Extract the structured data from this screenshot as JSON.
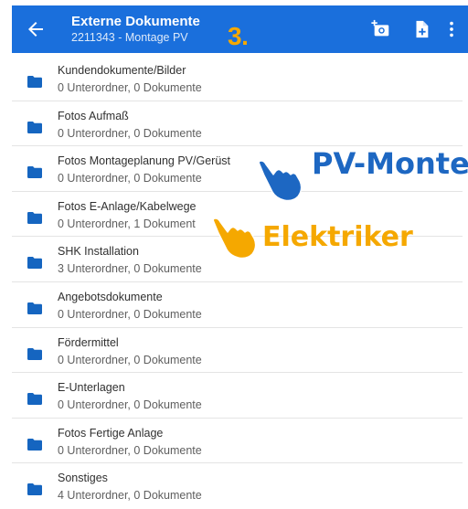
{
  "header": {
    "back_icon": "arrow-left-icon",
    "title": "Externe Dokumente",
    "subtitle": "2211343 - Montage PV",
    "step_annotation": "3.",
    "actions": [
      {
        "icon": "add-photo-icon"
      },
      {
        "icon": "add-document-icon"
      },
      {
        "icon": "more-vertical-icon"
      }
    ]
  },
  "folders": [
    {
      "name": "Kundendokumente/Bilder",
      "meta": "0 Unterordner, 0 Dokumente"
    },
    {
      "name": "Fotos Aufmaß",
      "meta": "0 Unterordner, 0 Dokumente"
    },
    {
      "name": "Fotos Montageplanung PV/Gerüst",
      "meta": "0 Unterordner, 0 Dokumente"
    },
    {
      "name": "Fotos E-Anlage/Kabelwege",
      "meta": "0 Unterordner, 1 Dokument"
    },
    {
      "name": "SHK Installation",
      "meta": "3 Unterordner, 0 Dokumente"
    },
    {
      "name": "Angebotsdokumente",
      "meta": "0 Unterordner, 0 Dokumente"
    },
    {
      "name": "Fördermittel",
      "meta": "0 Unterordner, 0 Dokumente"
    },
    {
      "name": "E-Unterlagen",
      "meta": "0 Unterordner, 0 Dokumente"
    },
    {
      "name": "Fotos Fertige Anlage",
      "meta": "0 Unterordner, 0 Dokumente"
    },
    {
      "name": "Sonstiges",
      "meta": "4 Unterordner, 0 Dokumente"
    }
  ],
  "annotations": {
    "pv": {
      "text": "PV-Monte",
      "color": "#1d67c2"
    },
    "elektriker": {
      "text": "Elektriker",
      "color": "#f5a800"
    }
  },
  "colors": {
    "app_bar": "#1a6fdc",
    "folder_icon": "#1565c0",
    "annotation_yellow": "#f5a800",
    "annotation_blue": "#1d67c2"
  }
}
